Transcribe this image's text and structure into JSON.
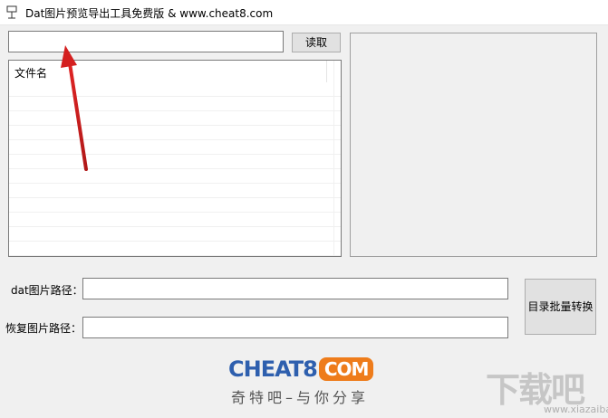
{
  "window": {
    "title": "Dat图片预览导出工具免费版 & www.cheat8.com"
  },
  "top": {
    "path_value": "",
    "read_label": "读取"
  },
  "file_list": {
    "column_header": "文件名",
    "rows": []
  },
  "form": {
    "dat_path_label": "dat图片路径：",
    "dat_path_value": "",
    "restore_path_label": "恢复图片路径：",
    "restore_path_value": "",
    "batch_convert_label": "目录批量转换"
  },
  "branding": {
    "logo_cheat": "CHEAT8",
    "logo_com": "COM",
    "slogan": "奇特吧–与你分享",
    "watermark": "下载吧",
    "watermark_url": "www.xiazaiba.com"
  },
  "colors": {
    "logo_blue": "#2e5fae",
    "logo_orange": "#ee7c1b",
    "annotation_arrow": "#d42020"
  },
  "icons": {
    "app_icon": "app-window-icon",
    "annotation": "red-arrow-icon"
  }
}
